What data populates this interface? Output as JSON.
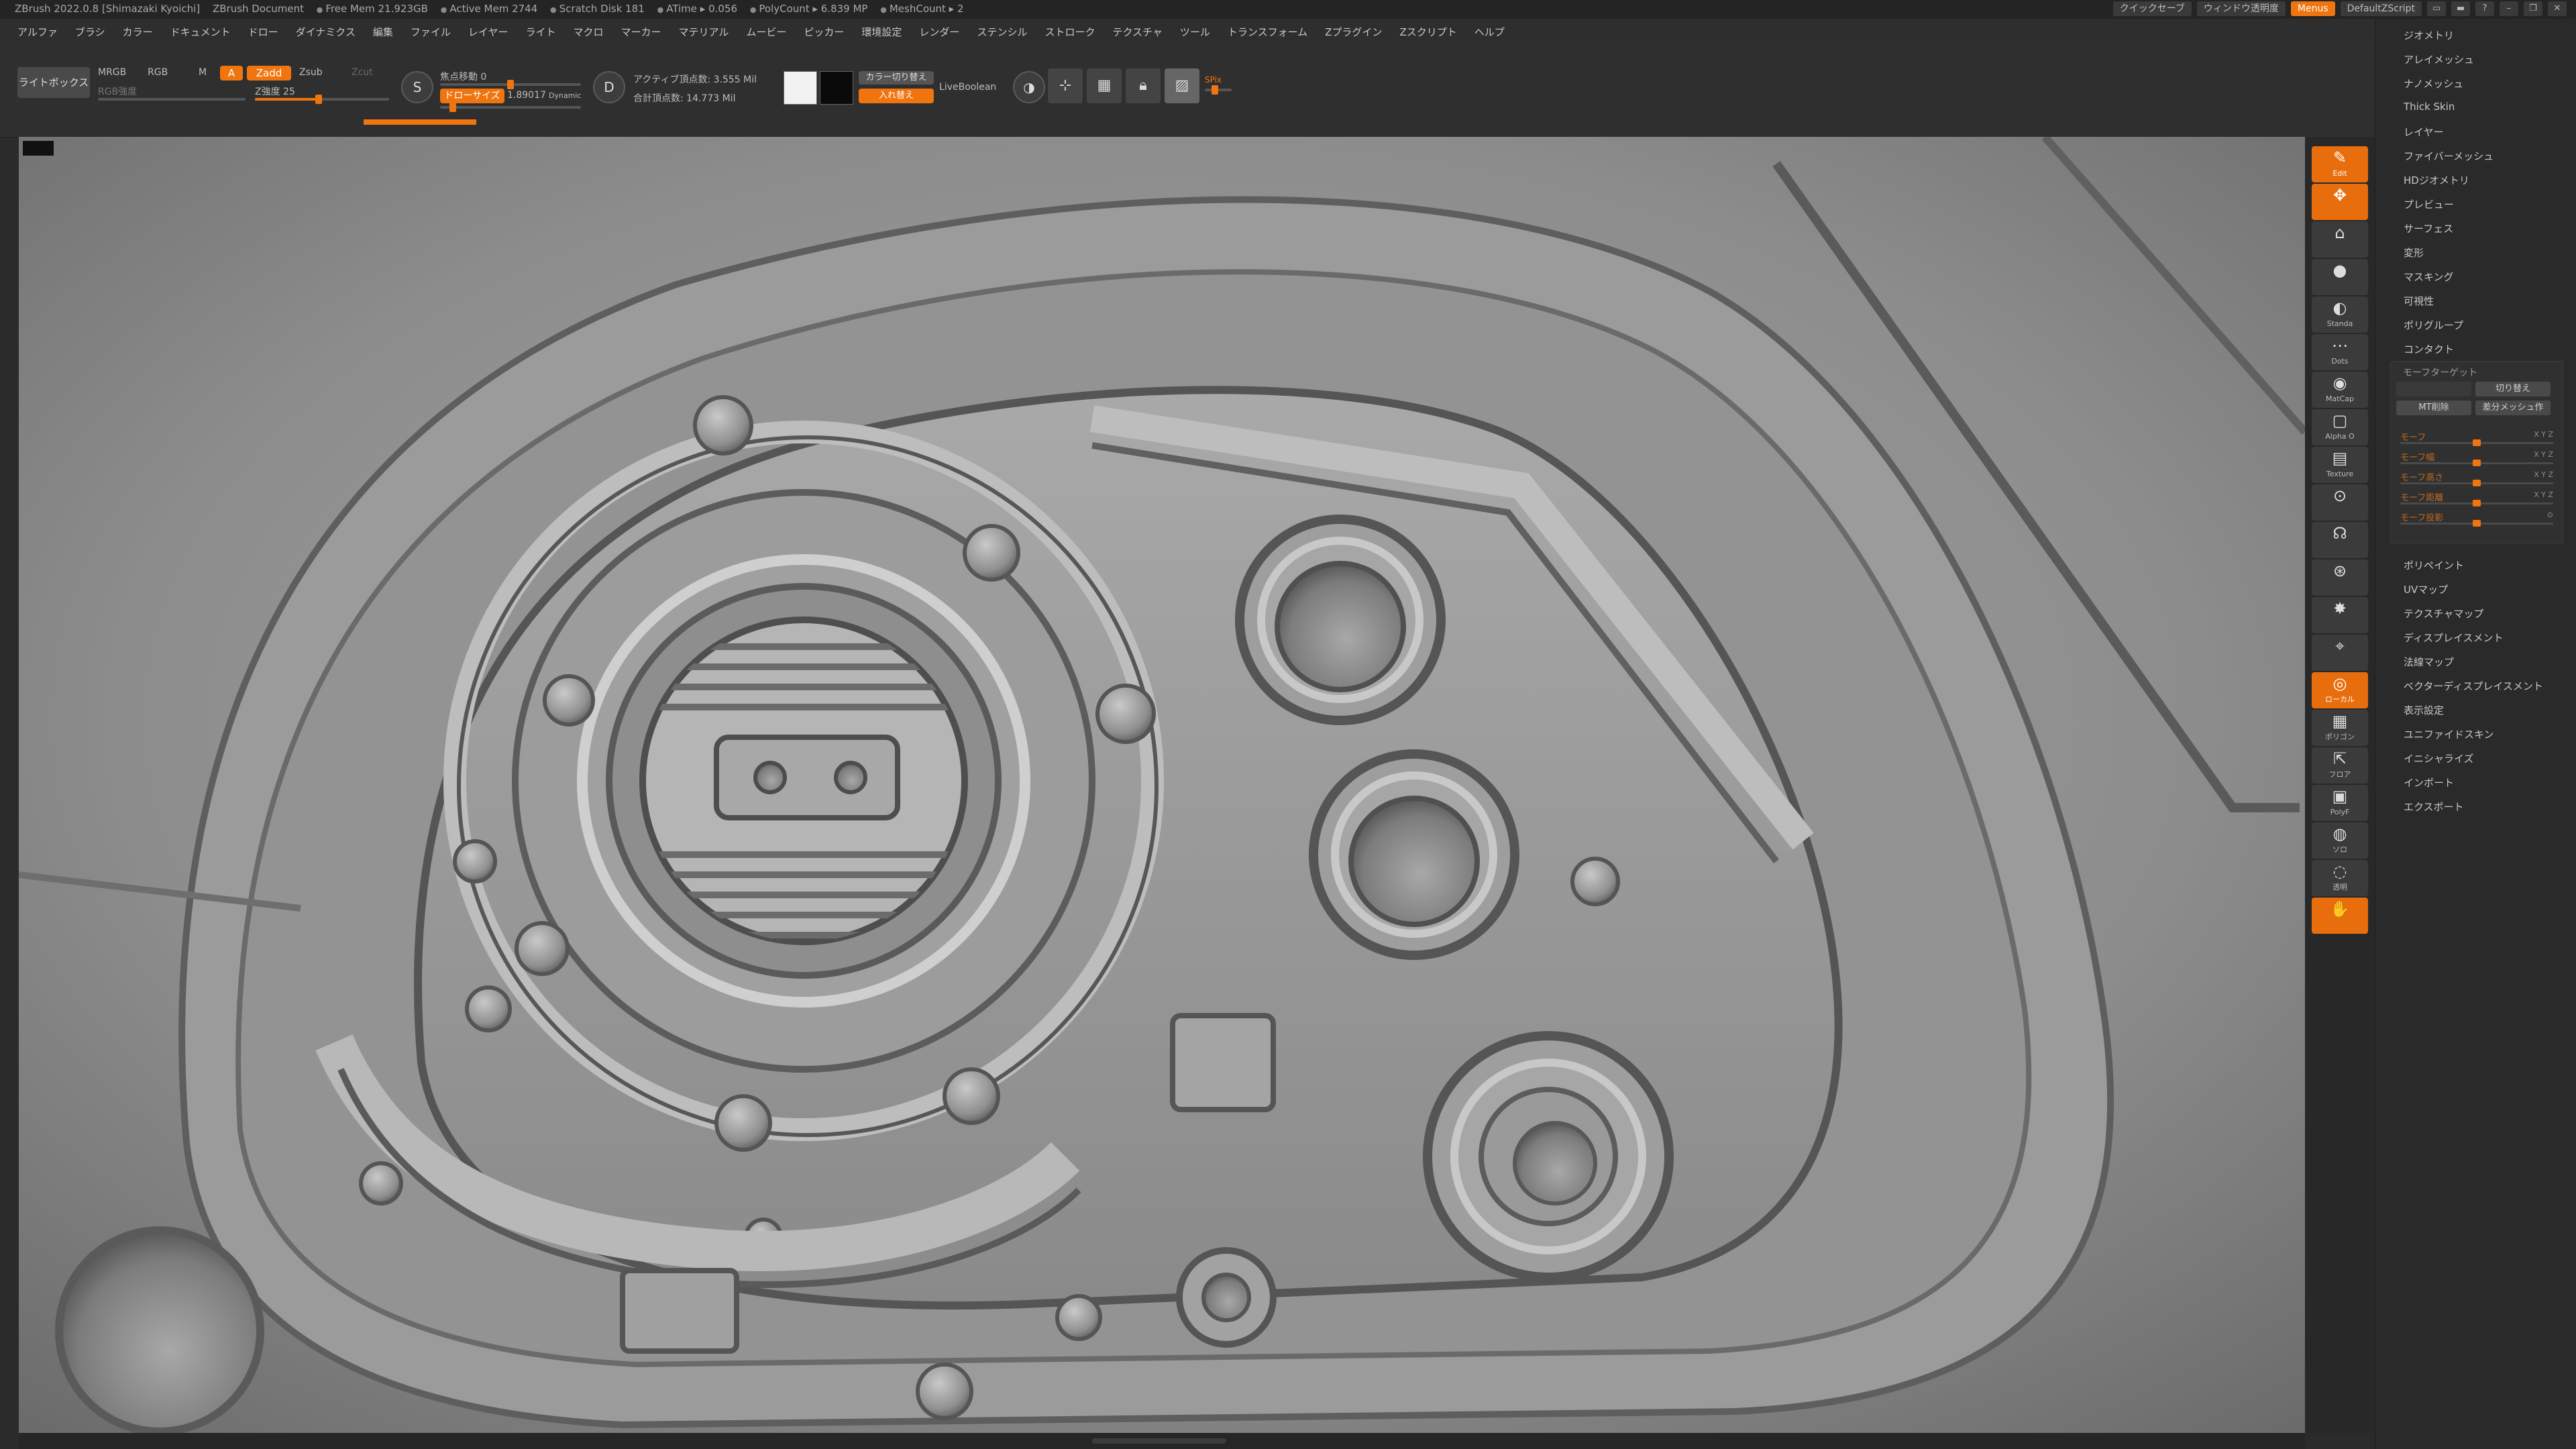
{
  "infobar": {
    "app_title": "ZBrush 2022.0.8 [Shimazaki Kyoichi]",
    "document": "ZBrush Document",
    "free_mem": "Free Mem 21.923GB",
    "active_mem": "Active Mem 2744",
    "scratch_disk": "Scratch Disk 181",
    "atime": "ATime ▸ 0.056",
    "polycount": "PolyCount ▸ 6.839 MP",
    "meshcount": "MeshCount ▸ 2",
    "quicksave": "クイックセーブ",
    "window_transparency": "ウィンドウ透明度",
    "menus": "Menus",
    "default_zscript": "DefaultZScript"
  },
  "menubar": {
    "items": [
      "アルファ",
      "ブラシ",
      "カラー",
      "ドキュメント",
      "ドロー",
      "ダイナミクス",
      "編集",
      "ファイル",
      "レイヤー",
      "ライト",
      "マクロ",
      "マーカー",
      "マテリアル",
      "ムービー",
      "ピッカー",
      "環境設定",
      "レンダー",
      "ステンシル",
      "ストローク",
      "テクスチャ",
      "ツール",
      "トランスフォーム",
      "Zプラグイン",
      "Zスクリプト",
      "ヘルプ"
    ]
  },
  "shelf": {
    "lightbox": "ライトボックス",
    "mrgb": "MRGB",
    "rgb": "RGB",
    "m": "M",
    "a": "A",
    "zadd": "Zadd",
    "zsub": "Zsub",
    "zcut": "Zcut",
    "rgb_intensity_label": "RGB強度",
    "z_intensity": "Z強度 25",
    "focal_shift": "焦点移動 0",
    "draw_size_label": "ドローサイズ",
    "draw_size_value": "1.89017",
    "dynamic": "Dynamic",
    "active_points": "アクティブ頂点数: 3.555 Mil",
    "total_points": "合計頂点数: 14.773 Mil",
    "color_switch": "カラー切り替え",
    "swap": "入れ替え",
    "live_boolean": "LiveBoolean",
    "spix": "SPix"
  },
  "toolcol": {
    "items": [
      {
        "icon": "✎",
        "label": "Edit",
        "orange": true
      },
      {
        "icon": "✥",
        "label": "",
        "orange": true
      },
      {
        "icon": "⌂",
        "label": "",
        "orange": false
      },
      {
        "icon": "●",
        "label": "",
        "orange": false
      },
      {
        "icon": "◐",
        "label": "Standa",
        "orange": false
      },
      {
        "icon": "⋯",
        "label": "Dots",
        "orange": false
      },
      {
        "icon": "◉",
        "label": "MatCap",
        "orange": false
      },
      {
        "icon": "▢",
        "label": "Alpha O",
        "orange": false
      },
      {
        "icon": "▤",
        "label": "Texture",
        "orange": false
      },
      {
        "icon": "⊙",
        "label": "",
        "orange": false
      },
      {
        "icon": "☊",
        "label": "",
        "orange": false
      },
      {
        "icon": "⊛",
        "label": "",
        "orange": false
      },
      {
        "icon": "✸",
        "label": "",
        "orange": false
      },
      {
        "icon": "⌖",
        "label": "",
        "orange": false
      },
      {
        "icon": "◎",
        "label": "ローカル",
        "orange": true
      },
      {
        "icon": "▦",
        "label": "ポリゴン",
        "orange": false
      },
      {
        "icon": "⇱",
        "label": "フロア",
        "orange": false
      },
      {
        "icon": "▣",
        "label": "PolyF",
        "orange": false
      },
      {
        "icon": "◍",
        "label": "ソロ",
        "orange": false
      },
      {
        "icon": "◌",
        "label": "透明",
        "orange": false
      },
      {
        "icon": "✋",
        "label": "",
        "orange": true
      }
    ]
  },
  "palette": {
    "items_top": [
      "ジオメトリ",
      "アレイメッシュ",
      "ナノメッシュ",
      "Thick Skin",
      "レイヤー",
      "ファイバーメッシュ",
      "HDジオメトリ",
      "プレビュー",
      "サーフェス",
      "変形",
      "マスキング",
      "可視性",
      "ポリグループ",
      "コンタクト"
    ],
    "morph": {
      "title": "モーフターゲット",
      "switch": "切り替え",
      "mt_delete": "MT削除",
      "diff_mesh": "差分メッシュ作",
      "rows": [
        {
          "label": "モーフ",
          "axes": "X Y Z"
        },
        {
          "label": "モーフ幅",
          "axes": "X Y Z"
        },
        {
          "label": "モーフ高さ",
          "axes": "X Y Z"
        },
        {
          "label": "モーフ距離",
          "axes": "X Y Z"
        },
        {
          "label": "モーフ投影",
          "axes": "⊙"
        }
      ]
    },
    "items_bottom": [
      "ポリペイント",
      "UVマップ",
      "テクスチャマップ",
      "ディスプレイスメント",
      "法線マップ",
      "ベクターディスプレイスメント",
      "表示設定",
      "ユニファイドスキン",
      "イニシャライズ",
      "インポート",
      "エクスポート"
    ]
  },
  "colors": {
    "accent": "#f0750f",
    "background": "#2b2b2b",
    "clay": "#8c8c8c"
  }
}
